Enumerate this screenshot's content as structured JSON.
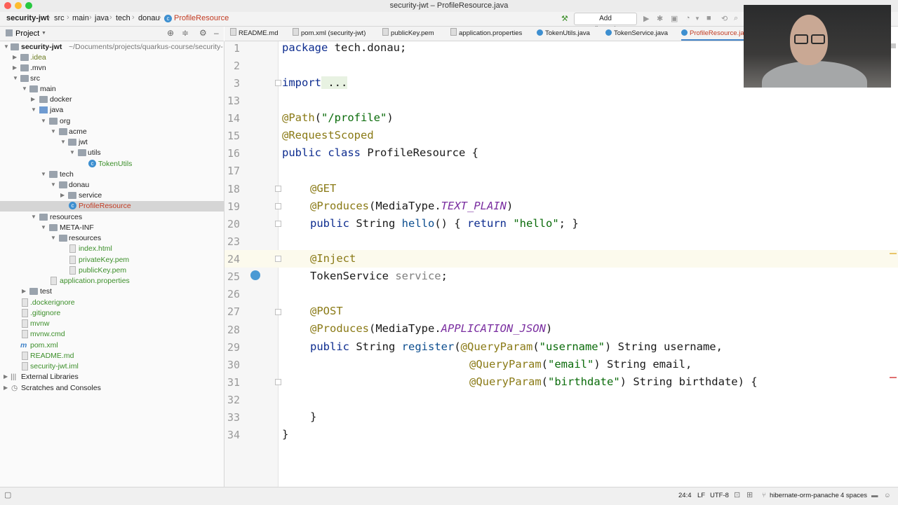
{
  "window": {
    "title": "security-jwt – ProfileResource.java"
  },
  "breadcrumbs": [
    "security-jwt",
    "src",
    "main",
    "java",
    "tech",
    "donau",
    "ProfileResource"
  ],
  "toolbar": {
    "add_configuration": "Add Configuration..."
  },
  "project_panel": {
    "title": "Project",
    "root_label": "security-jwt",
    "root_path": "~/Documents/projects/quarkus-course/security-",
    "items": [
      ".idea",
      ".mvn",
      "src",
      "main",
      "docker",
      "java",
      "org",
      "acme",
      "jwt",
      "utils",
      "TokenUtils",
      "tech",
      "donau",
      "service",
      "ProfileResource",
      "resources",
      "META-INF",
      "resources",
      "index.html",
      "privateKey.pem",
      "publicKey.pem",
      "application.properties",
      "test",
      ".dockerignore",
      ".gitignore",
      "mvnw",
      "mvnw.cmd",
      "pom.xml",
      "README.md",
      "security-jwt.iml",
      "External Libraries",
      "Scratches and Consoles"
    ]
  },
  "tabs": [
    "README.md",
    "pom.xml (security-jwt)",
    "publicKey.pem",
    "application.properties",
    "TokenUtils.java",
    "TokenService.java",
    "ProfileResource.java"
  ],
  "editor": {
    "line_numbers": [
      "1",
      "2",
      "3",
      "13",
      "14",
      "15",
      "16",
      "17",
      "18",
      "19",
      "20",
      "23",
      "24",
      "25",
      "26",
      "27",
      "28",
      "29",
      "30",
      "31",
      "32",
      "33",
      "34"
    ],
    "tokens": {
      "l1a": "package",
      "l1b": " tech.donau;",
      "l3a": "import",
      "l3b": " ...",
      "l14a": "@Path",
      "l14b": "(",
      "l14c": "\"/profile\"",
      "l14d": ")",
      "l15a": "@RequestScoped",
      "l16a": "public class",
      "l16b": " ProfileResource {",
      "l18a": "@GET",
      "l19a": "@Produces",
      "l19b": "(MediaType.",
      "l19c": "TEXT_PLAIN",
      "l19d": ")",
      "l20a": "public",
      "l20b": " String ",
      "l20c": "hello",
      "l20d": "() { ",
      "l20e": "return",
      "l20f": " ",
      "l20g": "\"hello\"",
      "l20h": "; }",
      "l24a": "@Inject",
      "l25a": "TokenService",
      "l25b": " service",
      "l25c": ";",
      "l27a": "@POST",
      "l28a": "@Produces",
      "l28b": "(MediaType.",
      "l28c": "APPLICATION_JSON",
      "l28d": ")",
      "l29a": "public",
      "l29b": " String ",
      "l29c": "register",
      "l29d": "(",
      "l29e": "@QueryParam",
      "l29f": "(",
      "l29g": "\"username\"",
      "l29h": ") String username,",
      "l30a": "@QueryParam",
      "l30b": "(",
      "l30c": "\"email\"",
      "l30d": ") String email,",
      "l31a": "@QueryParam",
      "l31b": "(",
      "l31c": "\"birthdate\"",
      "l31d": ") String birthdate) {",
      "l33a": "}",
      "l34a": "}"
    }
  },
  "status_bar": {
    "position": "24:4",
    "line_sep": "LF",
    "encoding": "UTF-8",
    "context": "hibernate-orm-panache",
    "indent": "4 spaces"
  },
  "colors": {
    "accent": "#4083c9",
    "annotation": "#8a7a16",
    "string": "#0a6b0a",
    "keyword": "#0d2c8f"
  }
}
